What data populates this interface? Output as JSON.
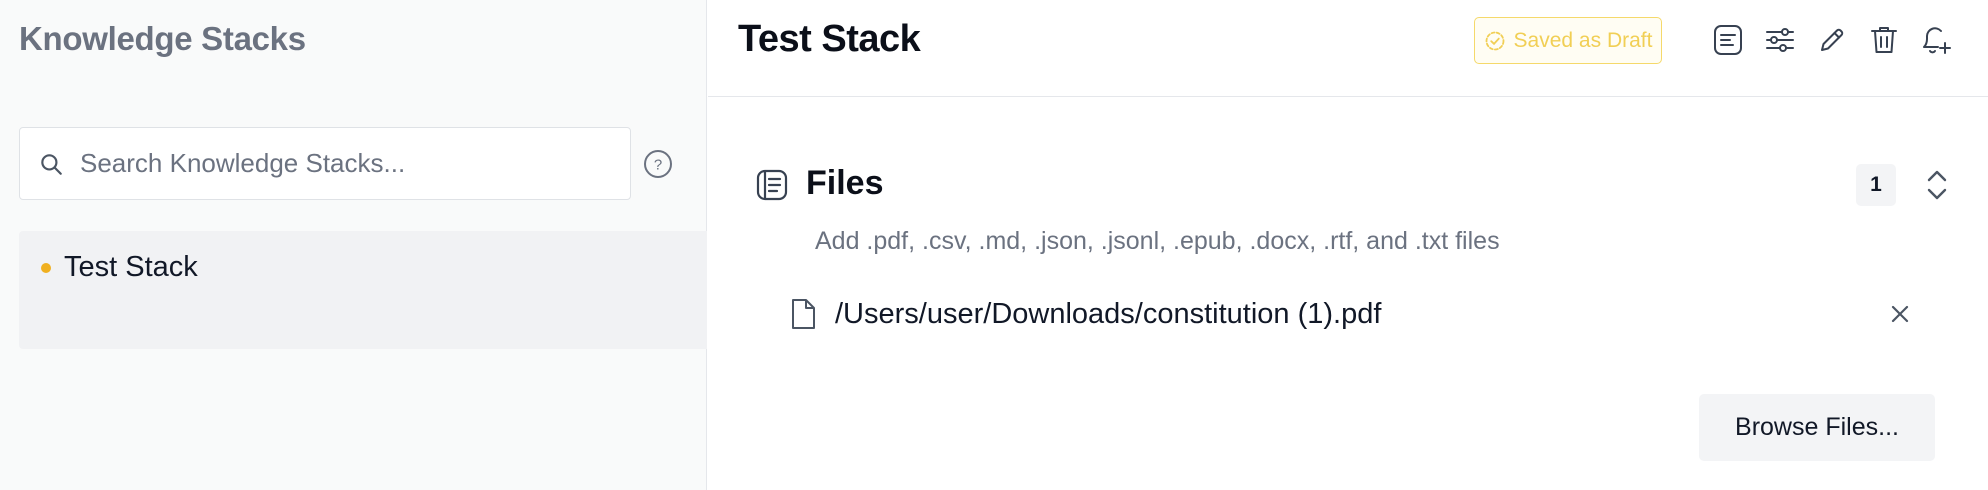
{
  "sidebar": {
    "title": "Knowledge Stacks",
    "search": {
      "placeholder": "Search Knowledge Stacks...",
      "value": ""
    },
    "items": [
      {
        "label": "Test Stack",
        "status_color": "#f0b020",
        "selected": true
      }
    ]
  },
  "header": {
    "title": "Test Stack",
    "status_badge": "Saved as Draft",
    "toolbar_icons": [
      "document-summary-icon",
      "sliders-icon",
      "pencil-icon",
      "trash-icon",
      "bell-plus-icon"
    ]
  },
  "files": {
    "title": "Files",
    "count": "1",
    "subtitle": "Add .pdf, .csv, .md, .json, .jsonl, .epub, .docx, .rtf, and .txt files",
    "items": [
      {
        "path": "/Users/user/Downloads/constitution (1).pdf"
      }
    ],
    "browse_label": "Browse Files..."
  },
  "colors": {
    "accent_draft": "#f1cf55",
    "status_dot": "#f0b020",
    "muted_text": "#6b7280"
  }
}
